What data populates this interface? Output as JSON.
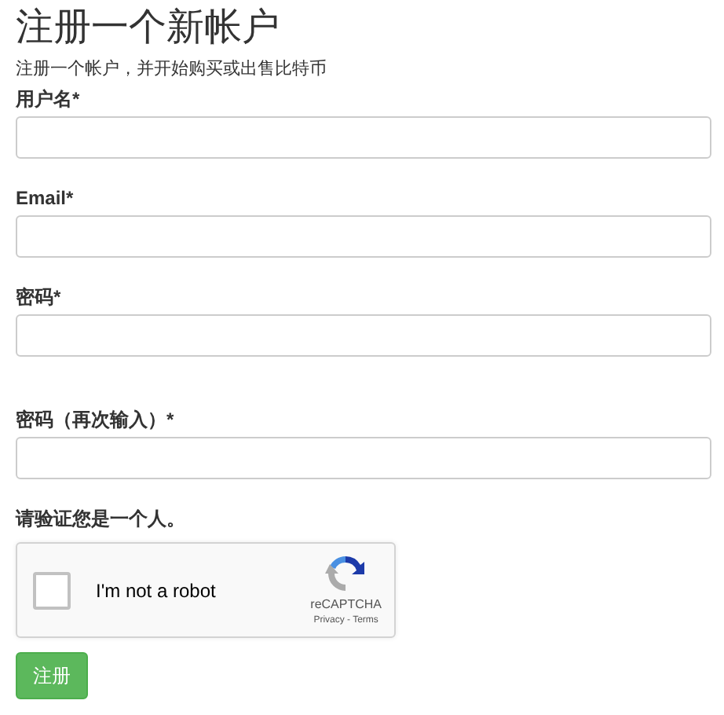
{
  "title": "注册一个新帐户",
  "subtitle": "注册一个帐户，并开始购买或出售比特币",
  "fields": [
    {
      "label": "用户名*"
    },
    {
      "label": "Email*"
    },
    {
      "label": "密码*"
    },
    {
      "label": "密码（再次输入）*"
    }
  ],
  "captcha": {
    "label": "请验证您是一个人。",
    "checkbox_text": "I'm not a robot",
    "checked": false,
    "brand": "reCAPTCHA",
    "links": "Privacy - Terms"
  },
  "submit": "注册"
}
